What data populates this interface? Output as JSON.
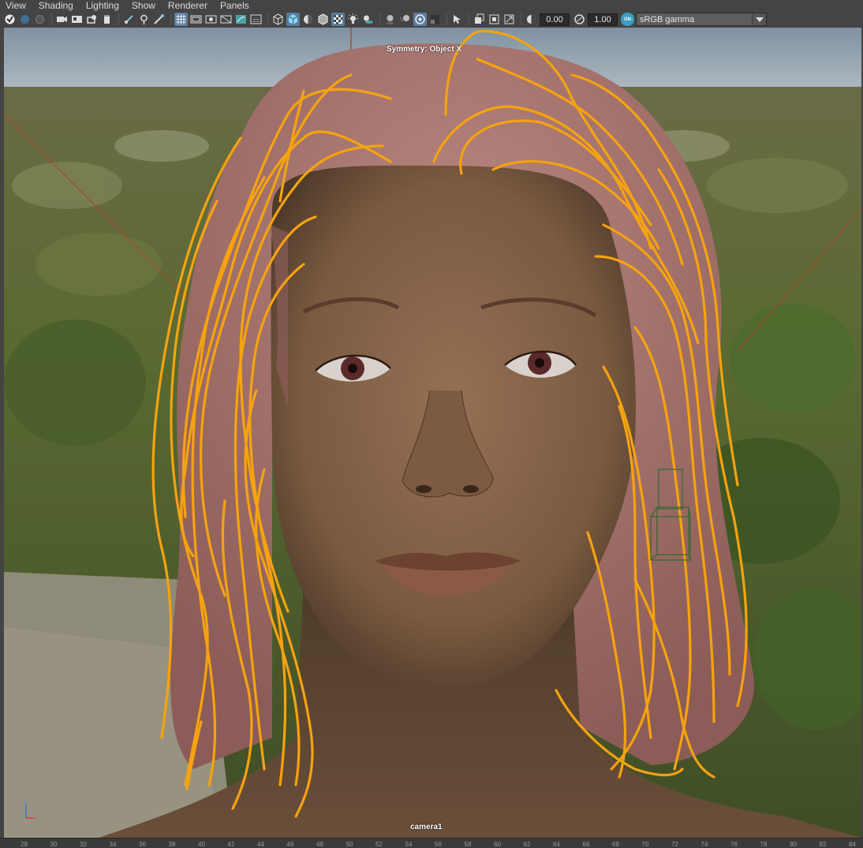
{
  "menubar": {
    "items": [
      "View",
      "Shading",
      "Lighting",
      "Show",
      "Renderer",
      "Panels"
    ]
  },
  "toolbar": {
    "exposure_value": "0.00",
    "gamma_value": "1.00",
    "color_management_label": "ON",
    "view_transform": "sRGB gamma",
    "icons": [
      "select-camera-icon",
      "lock-camera-icon",
      "camera-attributes-icon",
      "bookmark-icon",
      "image-plane-icon",
      "2d-pan-zoom-icon",
      "grease-pencil-icon",
      "grid-icon",
      "film-gate-icon",
      "resolution-gate-icon",
      "gate-mask-icon",
      "field-chart-icon",
      "safe-action-icon",
      "wireframe-icon",
      "smooth-shade-icon",
      "use-default-material-icon",
      "wireframe-on-shaded-icon",
      "textured-icon",
      "use-lights-icon",
      "shadows-icon",
      "screen-space-ao-icon",
      "motion-blur-icon",
      "multisample-aa-icon",
      "depth-of-field-icon",
      "isolate-select-icon",
      "xray-icon",
      "xray-joints-icon",
      "xray-components-icon",
      "exposure-icon",
      "gamma-icon"
    ]
  },
  "viewport": {
    "symmetry_label": "Symmetry: Object X",
    "camera_label": "camera1",
    "colors": {
      "guide_curves": "#f5a30f",
      "hair": "#b57a73",
      "skin": "#8a6346",
      "sky": "#8ea0b0",
      "foliage": "#55602f"
    }
  },
  "ruler": {
    "ticks": [
      "28",
      "30",
      "32",
      "34",
      "36",
      "38",
      "40",
      "42",
      "44",
      "46",
      "48",
      "50",
      "52",
      "54",
      "56",
      "58",
      "60",
      "62",
      "64",
      "66",
      "68",
      "70",
      "72",
      "74",
      "76",
      "78",
      "80",
      "82",
      "84"
    ]
  }
}
